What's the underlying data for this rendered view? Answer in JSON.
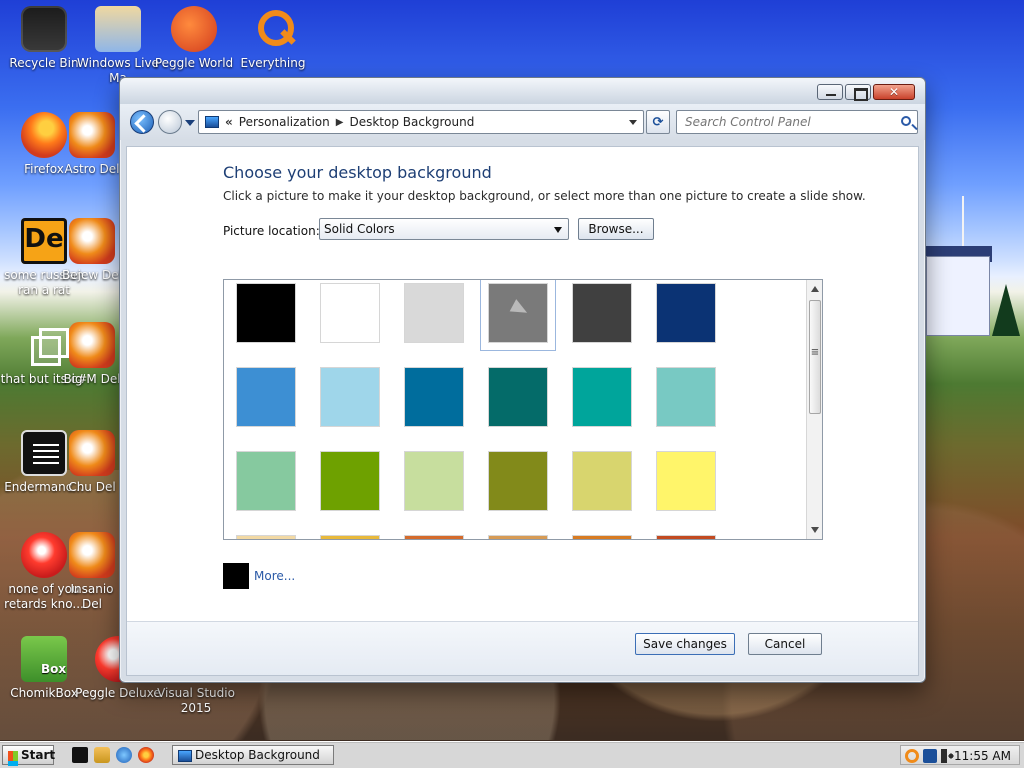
{
  "desktop": {
    "icons": [
      {
        "id": "recycle-bin",
        "label": "Recycle Bin"
      },
      {
        "id": "windows-live-mail",
        "label": "Windows Live Ma"
      },
      {
        "id": "peggle-world",
        "label": "Peggle World"
      },
      {
        "id": "everything",
        "label": "Everything"
      },
      {
        "id": "firefox",
        "label": "Firefox"
      },
      {
        "id": "astro-deluxe",
        "label": "Astro Del"
      },
      {
        "id": "some-russian",
        "label": "some russian ran a rat"
      },
      {
        "id": "bejeweled-deluxe",
        "label": "Bejew Del"
      },
      {
        "id": "that-but-its-c",
        "label": "that but its c#"
      },
      {
        "id": "big-money-deluxe",
        "label": "Big M Del"
      },
      {
        "id": "endermanc",
        "label": "Endermanc..."
      },
      {
        "id": "chuzzle-deluxe",
        "label": "Chu Del"
      },
      {
        "id": "none-of-you",
        "label": "none of you retards kno..."
      },
      {
        "id": "insaniquarium-deluxe",
        "label": "Insanio Del"
      },
      {
        "id": "chomikbox",
        "label": "ChomikBox"
      },
      {
        "id": "peggle-deluxe",
        "label": "Peggle Deluxe"
      },
      {
        "id": "visual-studio-2015",
        "label": "Visual Studio 2015"
      }
    ]
  },
  "window": {
    "address": {
      "root_sep": "«",
      "crumbs": [
        "Personalization",
        "Desktop Background"
      ]
    },
    "search": {
      "placeholder": "Search Control Panel"
    },
    "content": {
      "title": "Choose your desktop background",
      "subtitle": "Click a picture to make it your desktop background, or select more than one picture to create a slide show.",
      "picture_location_label": "Picture location:",
      "picture_location_value": "Solid Colors",
      "browse_label": "Browse...",
      "colors": [
        "#000000",
        "#ffffff",
        "#d9d9d9",
        "#7a7a7a",
        "#404040",
        "#0b3374",
        "#3d8fd3",
        "#9fd6ea",
        "#006d9d",
        "#046b69",
        "#00a59b",
        "#78c9c3",
        "#86c99f",
        "#6ea100",
        "#c7de9e",
        "#828a1a",
        "#d8d56e",
        "#fff56a",
        "#f2d9a4",
        "#e8b93b",
        "#d46b2c",
        "#d79b55",
        "#d87b22",
        "#c24a21"
      ],
      "selected_index": 3,
      "more_label": "More..."
    },
    "footer": {
      "save_label": "Save changes",
      "cancel_label": "Cancel"
    }
  },
  "taskbar": {
    "start_label": "Start",
    "task_label": "Desktop Background",
    "time": "11:55 AM"
  }
}
